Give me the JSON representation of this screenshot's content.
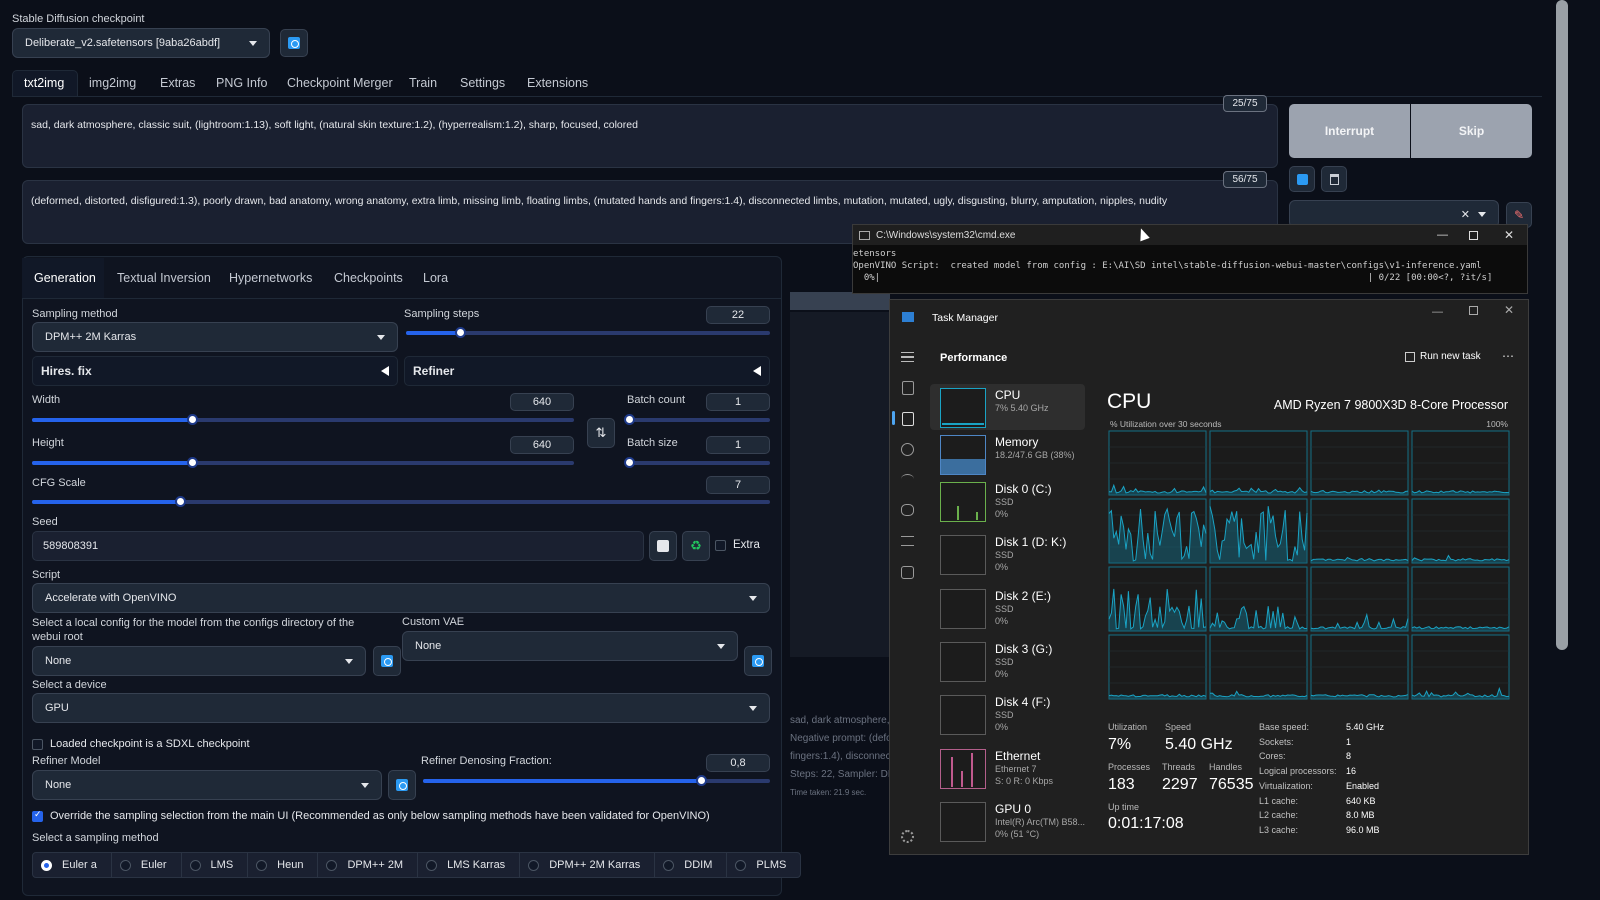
{
  "checkpoint": {
    "label": "Stable Diffusion checkpoint",
    "value": "Deliberate_v2.safetensors [9aba26abdf]"
  },
  "main_tabs": [
    "txt2img",
    "img2img",
    "Extras",
    "PNG Info",
    "Checkpoint Merger",
    "Train",
    "Settings",
    "Extensions"
  ],
  "prompt": {
    "text": "sad, dark atmosphere, classic suit, (lightroom:1.13), soft light, (natural skin texture:1.2), (hyperrealism:1.2), sharp, focused, colored",
    "counter": "25/75"
  },
  "negative_prompt": {
    "text": "(deformed, distorted, disfigured:1.3), poorly drawn, bad anatomy, wrong anatomy, extra limb, missing limb, floating limbs, (mutated hands and fingers:1.4), disconnected limbs, mutation, mutated, ugly, disgusting, blurry, amputation, nipples, nudity",
    "counter": "56/75"
  },
  "actions": {
    "interrupt": "Interrupt",
    "skip": "Skip"
  },
  "sub_tabs": [
    "Generation",
    "Textual Inversion",
    "Hypernetworks",
    "Checkpoints",
    "Lora"
  ],
  "sampling": {
    "method_label": "Sampling method",
    "method": "DPM++ 2M Karras",
    "steps_label": "Sampling steps",
    "steps": "22",
    "steps_fraction": 0.148
  },
  "hires": "Hires. fix",
  "refiner": "Refiner",
  "width": {
    "label": "Width",
    "value": "640",
    "fraction": 0.296
  },
  "height": {
    "label": "Height",
    "value": "640",
    "fraction": 0.296
  },
  "batch_count": {
    "label": "Batch count",
    "value": "1",
    "fraction": 0.0
  },
  "batch_size": {
    "label": "Batch size",
    "value": "1",
    "fraction": 0.0
  },
  "cfg": {
    "label": "CFG Scale",
    "value": "7",
    "fraction": 0.2
  },
  "seed": {
    "label": "Seed",
    "value": "589808391",
    "extra": "Extra"
  },
  "script": {
    "label": "Script",
    "value": "Accelerate with OpenVINO"
  },
  "local_config": {
    "label": "Select a local config for the model from the configs directory of the webui root",
    "value": "None"
  },
  "custom_vae": {
    "label": "Custom VAE",
    "value": "None"
  },
  "device": {
    "label": "Select a device",
    "value": "GPU"
  },
  "sdxl_checkbox": "Loaded checkpoint is a SDXL checkpoint",
  "refiner_model": {
    "label": "Refiner Model",
    "value": "None"
  },
  "refiner_denoise": {
    "label": "Refiner Denosing Fraction:",
    "value": "0,8",
    "fraction": 0.8
  },
  "override_checkbox": "Override the sampling selection from the main UI (Recommended as only below sampling methods have been validated for OpenVINO)",
  "sampling_select_label": "Select a sampling method",
  "samplers": [
    "Euler a",
    "Euler",
    "LMS",
    "Heun",
    "DPM++ 2M",
    "LMS Karras",
    "DPM++ 2M Karras",
    "DDIM",
    "PLMS"
  ],
  "selected_sampler": "Euler a",
  "output_info": [
    "sad, dark atmosphere,",
    "Negative prompt: (defo",
    "fingers:1.4), disconnec",
    "Steps: 22, Sampler: DP",
    "Time taken: 21.9 sec."
  ],
  "cmd": {
    "title": "C:\\Windows\\system32\\cmd.exe",
    "lines": [
      "etensors",
      "OpenVINO Script:  created model from config : E:\\AI\\SD intel\\stable-diffusion-webui-master\\configs\\v1-inference.yaml",
      "  0%|                                                                                          | 0/22 [00:00<?, ?it/s]"
    ]
  },
  "taskmgr": {
    "title": "Task Manager",
    "section": "Performance",
    "run_new_task": "Run new task",
    "side": [
      {
        "name": "CPU",
        "sub1": "7% 5.40 GHz",
        "sub2": "",
        "sub3": ""
      },
      {
        "name": "Memory",
        "sub1": "18.2/47.6 GB (38%)",
        "sub2": "",
        "sub3": ""
      },
      {
        "name": "Disk 0 (C:)",
        "sub1": "SSD",
        "sub2": "0%",
        "sub3": ""
      },
      {
        "name": "Disk 1 (D: K:)",
        "sub1": "SSD",
        "sub2": "0%",
        "sub3": ""
      },
      {
        "name": "Disk 2 (E:)",
        "sub1": "SSD",
        "sub2": "0%",
        "sub3": ""
      },
      {
        "name": "Disk 3 (G:)",
        "sub1": "SSD",
        "sub2": "0%",
        "sub3": ""
      },
      {
        "name": "Disk 4 (F:)",
        "sub1": "SSD",
        "sub2": "0%",
        "sub3": ""
      },
      {
        "name": "Ethernet",
        "sub1": "Ethernet 7",
        "sub2": "S: 0 R: 0 Kbps",
        "sub3": ""
      },
      {
        "name": "GPU 0",
        "sub1": "Intel(R) Arc(TM) B58...",
        "sub2": "0% (51 °C)",
        "sub3": ""
      }
    ],
    "cpu_heading": "CPU",
    "cpu_model": "AMD Ryzen 7 9800X3D 8-Core Processor",
    "graph_label": "% Utilization over 30 seconds",
    "graph_max": "100%",
    "stats": {
      "utilization_label": "Utilization",
      "utilization": "7%",
      "speed_label": "Speed",
      "speed": "5.40 GHz",
      "processes_label": "Processes",
      "processes": "183",
      "threads_label": "Threads",
      "threads": "2297",
      "handles_label": "Handles",
      "handles": "76535",
      "uptime_label": "Up time",
      "uptime": "0:01:17:08"
    },
    "specs": [
      [
        "Base speed:",
        "5.40 GHz"
      ],
      [
        "Sockets:",
        "1"
      ],
      [
        "Cores:",
        "8"
      ],
      [
        "Logical processors:",
        "16"
      ],
      [
        "Virtualization:",
        "Enabled"
      ],
      [
        "L1 cache:",
        "640 KB"
      ],
      [
        "L2 cache:",
        "8.0 MB"
      ],
      [
        "L3 cache:",
        "96.0 MB"
      ]
    ]
  },
  "colors": {
    "accent": "#2563eb",
    "bg": "#0b0f19",
    "taskmgr_bg": "#202020",
    "graph_line": "#1aa3c4"
  }
}
